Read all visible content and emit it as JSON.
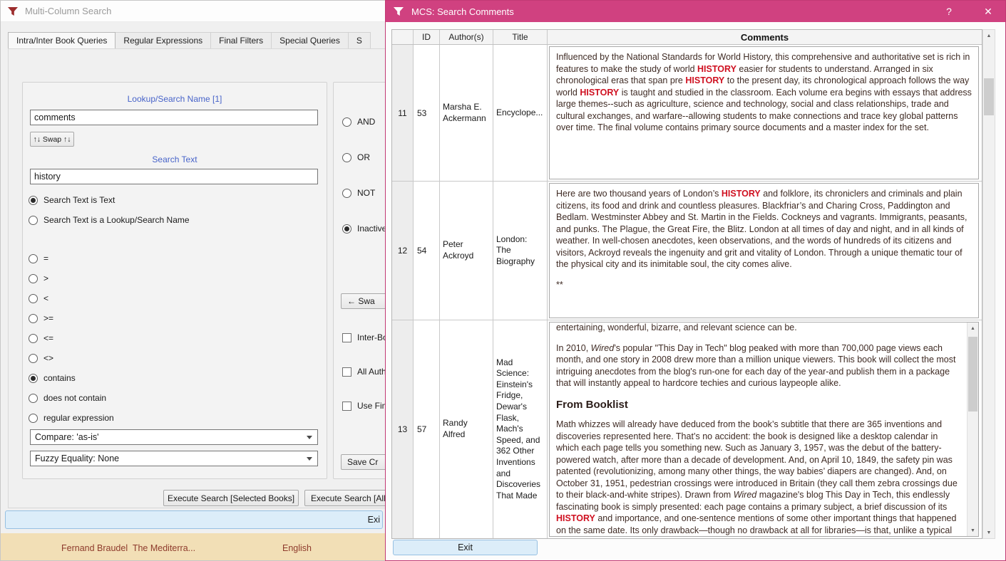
{
  "colors": {
    "titlebar_pink": "#d04180",
    "search_hit_red": "#cf1020",
    "label_blue": "#4763c9",
    "status_bar_tan": "#f2dfb6",
    "status_text_maroon": "#8e3b2c",
    "exit_button_blue": "#dcedf9"
  },
  "left_window": {
    "title": "Multi-Column Search",
    "tabs": [
      {
        "label": "Intra/Inter Book Queries",
        "active": true
      },
      {
        "label": "Regular Expressions",
        "active": false
      },
      {
        "label": "Final Filters",
        "active": false
      },
      {
        "label": "Special Queries",
        "active": false
      },
      {
        "label": "S",
        "active": false
      }
    ],
    "form": {
      "lookup_label": "Lookup/Search Name [1]",
      "lookup_value": "comments",
      "swap_button": "↑↓ Swap ↑↓",
      "search_text_label": "Search Text",
      "search_text_value": "history",
      "text_mode_radios": [
        {
          "label": "Search Text is Text",
          "selected": true
        },
        {
          "label": "Search Text is a Lookup/Search Name",
          "selected": false
        }
      ],
      "comparison_radios": [
        {
          "label": "=",
          "selected": false
        },
        {
          "label": ">",
          "selected": false
        },
        {
          "label": "<",
          "selected": false
        },
        {
          "label": ">=",
          "selected": false
        },
        {
          "label": "<=",
          "selected": false
        },
        {
          "label": "<>",
          "selected": false
        },
        {
          "label": "contains",
          "selected": true
        },
        {
          "label": "does not contain",
          "selected": false
        },
        {
          "label": "regular expression",
          "selected": false
        }
      ],
      "compare_dropdown": "Compare: 'as-is'",
      "fuzzy_dropdown": "Fuzzy Equality: None"
    },
    "logic_panel": {
      "radios": [
        {
          "label": "AND",
          "selected": false
        },
        {
          "label": "OR",
          "selected": false
        },
        {
          "label": "NOT",
          "selected": false
        },
        {
          "label": "Inactive",
          "selected": true
        }
      ],
      "swap_button": "← Swa",
      "checkboxes": [
        {
          "label": "Inter-Boo",
          "checked": false
        },
        {
          "label": "All Autho",
          "checked": false
        },
        {
          "label": "Use Final",
          "checked": false
        }
      ],
      "save_button": "Save Cr"
    },
    "execute_selected_button": "Execute Search [Selected Books]",
    "execute_all_button": "Execute Search [All",
    "exit_button": "Exi",
    "status": {
      "book": "Fernand Braudel  The Mediterra...",
      "language": "English"
    }
  },
  "right_window": {
    "title": "MCS: Search Comments",
    "help_button": "?",
    "close_button": "✕",
    "exit_button": "Exit",
    "table": {
      "headers": [
        "ID",
        "Author(s)",
        "Title",
        "Comments"
      ],
      "rows": [
        {
          "row_num": "11",
          "id": "53",
          "authors": "Marsha E. Ackermann",
          "title": "Encyclope...",
          "scrollbar": false,
          "comments": [
            {
              "type": "p",
              "runs": [
                {
                  "s": "n",
                  "t": "Influenced by the National Standards for World History, this comprehensive and authoritative set is rich in features to make the study of world "
                },
                {
                  "s": "hl",
                  "t": "HISTORY"
                },
                {
                  "s": "n",
                  "t": " easier for students to understand. Arranged in six chronological eras that span pre "
                },
                {
                  "s": "hl",
                  "t": "HISTORY"
                },
                {
                  "s": "n",
                  "t": " to the present day, its chronological approach follows the way world "
                },
                {
                  "s": "hl",
                  "t": "HISTORY"
                },
                {
                  "s": "n",
                  "t": " is taught and studied in the classroom. Each volume era begins with essays that address large themes--such as agriculture, science and technology, social and class relationships, trade and cultural exchanges, and warfare--allowing students to make connections and trace key global patterns over time. The final volume contains primary source documents and a master index for the set."
                }
              ]
            }
          ]
        },
        {
          "row_num": "12",
          "id": "54",
          "authors": "Peter Ackroyd",
          "title": "London: The Biography",
          "scrollbar": false,
          "comments": [
            {
              "type": "p",
              "runs": [
                {
                  "s": "n",
                  "t": "Here are two thousand years of London’s "
                },
                {
                  "s": "hl",
                  "t": "HISTORY"
                },
                {
                  "s": "n",
                  "t": " and folklore, its chroniclers and criminals and plain citizens, its food and drink and countless pleasures. Blackfriar’s and Charing Cross, Paddington and Bedlam. Westminster Abbey and St. Martin in the Fields. Cockneys and vagrants. Immigrants, peasants, and punks. The Plague, the Great Fire, the Blitz. London at all times of day and night, and in all kinds of weather. In well-chosen anecdotes, keen observations, and the words of hundreds of its citizens and visitors, Ackroyd reveals the ingenuity and grit and vitality of London. Through a unique thematic tour of the physical city and its inimitable soul, the city comes alive."
                }
              ]
            },
            {
              "type": "p",
              "runs": [
                {
                  "s": "n",
                  "t": "**"
                }
              ]
            }
          ]
        },
        {
          "row_num": "13",
          "id": "57",
          "authors": "Randy Alfred",
          "title": "Mad Science: Einstein's Fridge, Dewar's Flask, Mach's Speed, and 362 Other Inventions and Discoveries That Made",
          "scrollbar": true,
          "comments": [
            {
              "type": "p",
              "cls": "cut-top",
              "runs": [
                {
                  "s": "n",
                  "t": "entertaining, wonderful, bizarre, and relevant science can be."
                }
              ]
            },
            {
              "type": "p",
              "runs": [
                {
                  "s": "n",
                  "t": "In 2010, "
                },
                {
                  "s": "i",
                  "t": "Wired"
                },
                {
                  "s": "n",
                  "t": "’s popular \"This Day in Tech\" blog peaked with more than 700,000 page views each month, and one story in 2008 drew more than a million unique viewers. This book will collect the most intriguing anecdotes from the blog's run-one for each day of the year-and publish them in a package that will instantly appeal to hardcore techies and curious laypeople alike."
                }
              ]
            },
            {
              "type": "h3",
              "runs": [
                {
                  "s": "n",
                  "t": "From Booklist"
                }
              ]
            },
            {
              "type": "p",
              "runs": [
                {
                  "s": "n",
                  "t": "Math whizzes will already have deduced from the book’s subtitle that there are 365 inventions and discoveries represented here. That’s no accident: the book is designed like a desktop calendar in which each page tells you something new. Such as January 3, 1957, was the debut of the battery-powered watch, after more than a decade of development. And, on April 10, 1849, the safety pin was patented (revolutionizing, among many other things, the way babies’ diapers are changed). And, on October 31, 1951, pedestrian crossings were introduced in Britain (they call them zebra crossings due to their black-and-white stripes). Drawn from "
                },
                {
                  "s": "i",
                  "t": "Wired"
                },
                {
                  "s": "n",
                  "t": " magazine's blog This Day in Tech, this endlessly fascinating book is simply presented: each page contains a primary subject, a brief discussion of its "
                },
                {
                  "s": "hl",
                  "t": "HISTORY"
                },
                {
                  "s": "n",
                  "t": " and importance, and one-sentence mentions of some other important things that happened on the same date. Its only drawback—though no drawback at all for libraries—is that, unlike a typical desktop calendar, you can't tear off one page when it's time to"
                }
              ]
            }
          ]
        }
      ]
    }
  }
}
